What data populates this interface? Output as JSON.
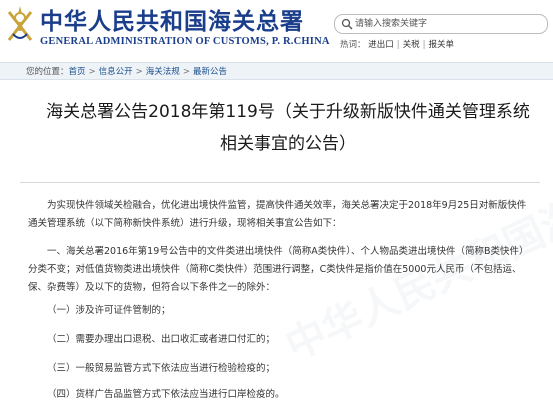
{
  "header": {
    "logo_cn": "中华人民共和国海关总署",
    "logo_en": "GENERAL ADMINISTRATION OF CUSTOMS, P. R.CHINA",
    "search_placeholder": "请输入搜索关键字",
    "hot_label": "热词：",
    "hot_words": [
      "进出口",
      "关税",
      "报关单"
    ]
  },
  "breadcrumb": {
    "label": "您的位置：",
    "items": [
      "首页",
      "信息公开",
      "海关法规",
      "最新公告"
    ]
  },
  "article": {
    "title": "海关总署公告2018年第119号（关于升级新版快件通关管理系统相关事宜的公告）",
    "paragraphs": [
      "为实现快件领域关检融合，优化进出境快件监管，提高快件通关效率，海关总署决定于2018年9月25日对新版快件通关管理系统（以下简称新快件系统）进行升级，现将相关事宜公告如下：",
      "一、海关总署2016年第19号公告中的文件类进出境快件（简称A类快件）、个人物品类进出境快件（简称B类快件）分类不变；对低值货物类进出境快件（简称C类快件）范围进行调整，C类快件是指价值在5000元人民币（不包括运、保、杂费等）及以下的货物，但符合以下条件之一的除外：",
      "（一）涉及许可证件管制的；",
      "（二）需要办理出口退税、出口收汇或者进口付汇的；",
      "（三）一般贸易监管方式下依法应当进行检验检疫的；",
      "（四）货样广告品监管方式下依法应当进行口岸检疫的。"
    ]
  },
  "colors": {
    "brand": "#1a3e8c",
    "link": "#1a4f8b",
    "breadcrumb_bg": "#eef3f8"
  },
  "icons": [
    "customs-emblem-icon",
    "search-icon"
  ]
}
